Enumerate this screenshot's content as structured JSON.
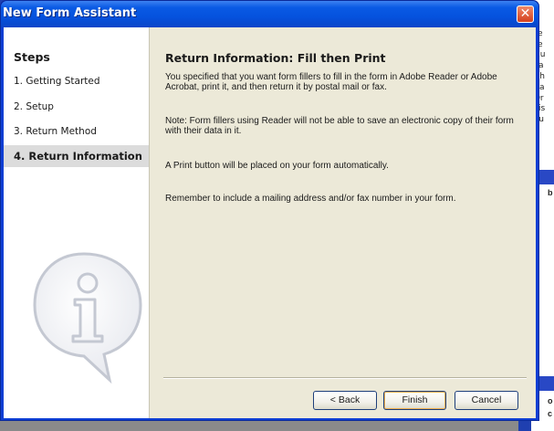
{
  "window": {
    "title": "New Form Assistant",
    "close_symbol": "✕"
  },
  "steps": {
    "heading": "Steps",
    "items": [
      {
        "label": "1. Getting Started"
      },
      {
        "label": "2. Setup"
      },
      {
        "label": "3. Return Method"
      },
      {
        "label": "4. Return Information"
      }
    ],
    "active_index": 3
  },
  "main": {
    "title": "Return Information: Fill then Print",
    "paragraphs": [
      "You specified that you want form fillers to fill in the form in Adobe Reader or Adobe Acrobat, print it, and then return it by postal mail or fax.",
      "Note: Form fillers using Reader will not be able to save an electronic copy of their form with their data in it.",
      "A Print button will be placed on your form automatically.",
      "Remember to include a mailing address and/or fax number in your form."
    ]
  },
  "buttons": {
    "back": "< Back",
    "finish": "Finish",
    "cancel": "Cancel"
  },
  "background_app": {
    "side_text": [
      "a",
      "Te",
      "Te",
      "Nu",
      "Pa",
      "Ch",
      "Ra",
      "Dr",
      "Lis",
      "Pu"
    ],
    "label_1": "b",
    "label_2": [
      "o",
      "c"
    ]
  },
  "colors": {
    "titlebar": "#0a5ae4",
    "client_bg": "#ece9d8",
    "close_button": "#d4401e"
  }
}
